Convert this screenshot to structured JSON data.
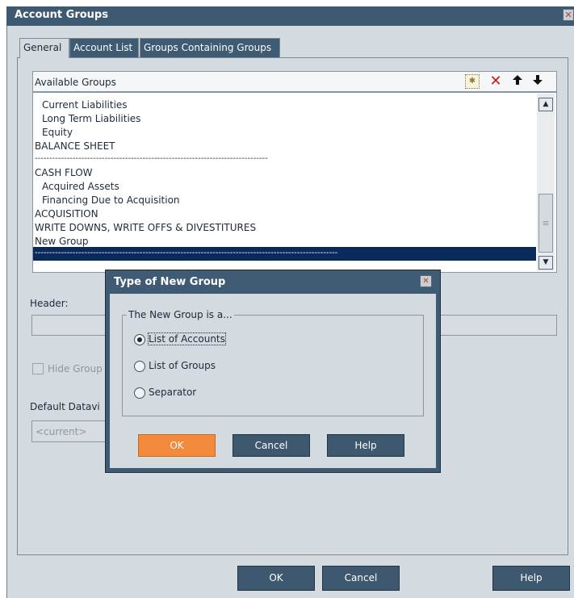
{
  "window": {
    "title": "Account Groups",
    "close_glyph": "✕"
  },
  "tabs": [
    {
      "label": "General"
    },
    {
      "label": "Account List"
    },
    {
      "label": "Groups Containing Groups"
    }
  ],
  "available_groups": {
    "label": "Available Groups",
    "toolbar": {
      "new_icon": "new-item-icon",
      "delete": "✕",
      "up": "🡅",
      "down": "🡇"
    },
    "items": [
      "Current Liabilities",
      "Long Term Liabilities",
      "Equity",
      "BALANCE SHEET",
      "--------------------------------------------------------------------------------",
      "CASH FLOW",
      "Acquired Assets",
      "Financing Due to Acquisition",
      "ACQUISITION",
      "WRITE DOWNS, WRITE OFFS & DIVESTITURES",
      "New Group"
    ],
    "selected_item": "--------------------------------------------------------------------------------------------------------",
    "scroll_up": "▲",
    "scroll_down": "▼",
    "scroll_grip": "≡"
  },
  "form": {
    "header_label": "Header:",
    "hide_label": "Hide Group",
    "dataview_label": "Default Datavi",
    "dataview_value": "<current>"
  },
  "buttons": {
    "ok": "OK",
    "cancel": "Cancel",
    "help": "Help"
  },
  "dialog": {
    "title": "Type of New Group",
    "close_glyph": "✕",
    "legend": "The New Group is a...",
    "options": [
      {
        "label": "List of Accounts",
        "selected": true
      },
      {
        "label": "List of Groups",
        "selected": false
      },
      {
        "label": "Separator",
        "selected": false
      }
    ],
    "ok": "OK",
    "cancel": "Cancel",
    "help": "Help"
  },
  "colors": {
    "titlebar": "#3e5a72",
    "selection": "#0b2a5c",
    "accent_button": "#f38a3b",
    "button": "#3d586f",
    "window_bg": "#d3dae0"
  }
}
